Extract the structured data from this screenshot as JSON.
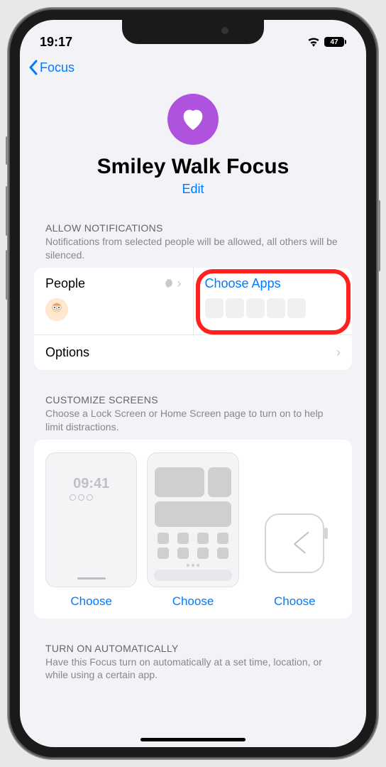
{
  "status": {
    "time": "19:17",
    "battery": "47"
  },
  "nav": {
    "back": "Focus"
  },
  "header": {
    "title": "Smiley Walk Focus",
    "edit": "Edit"
  },
  "notifications": {
    "section_title": "ALLOW NOTIFICATIONS",
    "section_desc": "Notifications from selected people will be allowed, all others will be silenced.",
    "people_label": "People",
    "apps_label": "Choose Apps",
    "options_label": "Options"
  },
  "customize": {
    "section_title": "CUSTOMIZE SCREENS",
    "section_desc": "Choose a Lock Screen or Home Screen page to turn on to help limit distractions.",
    "lock_time": "09:41",
    "choose": "Choose"
  },
  "auto": {
    "section_title": "TURN ON AUTOMATICALLY",
    "section_desc": "Have this Focus turn on automatically at a set time, location, or while using a certain app."
  }
}
